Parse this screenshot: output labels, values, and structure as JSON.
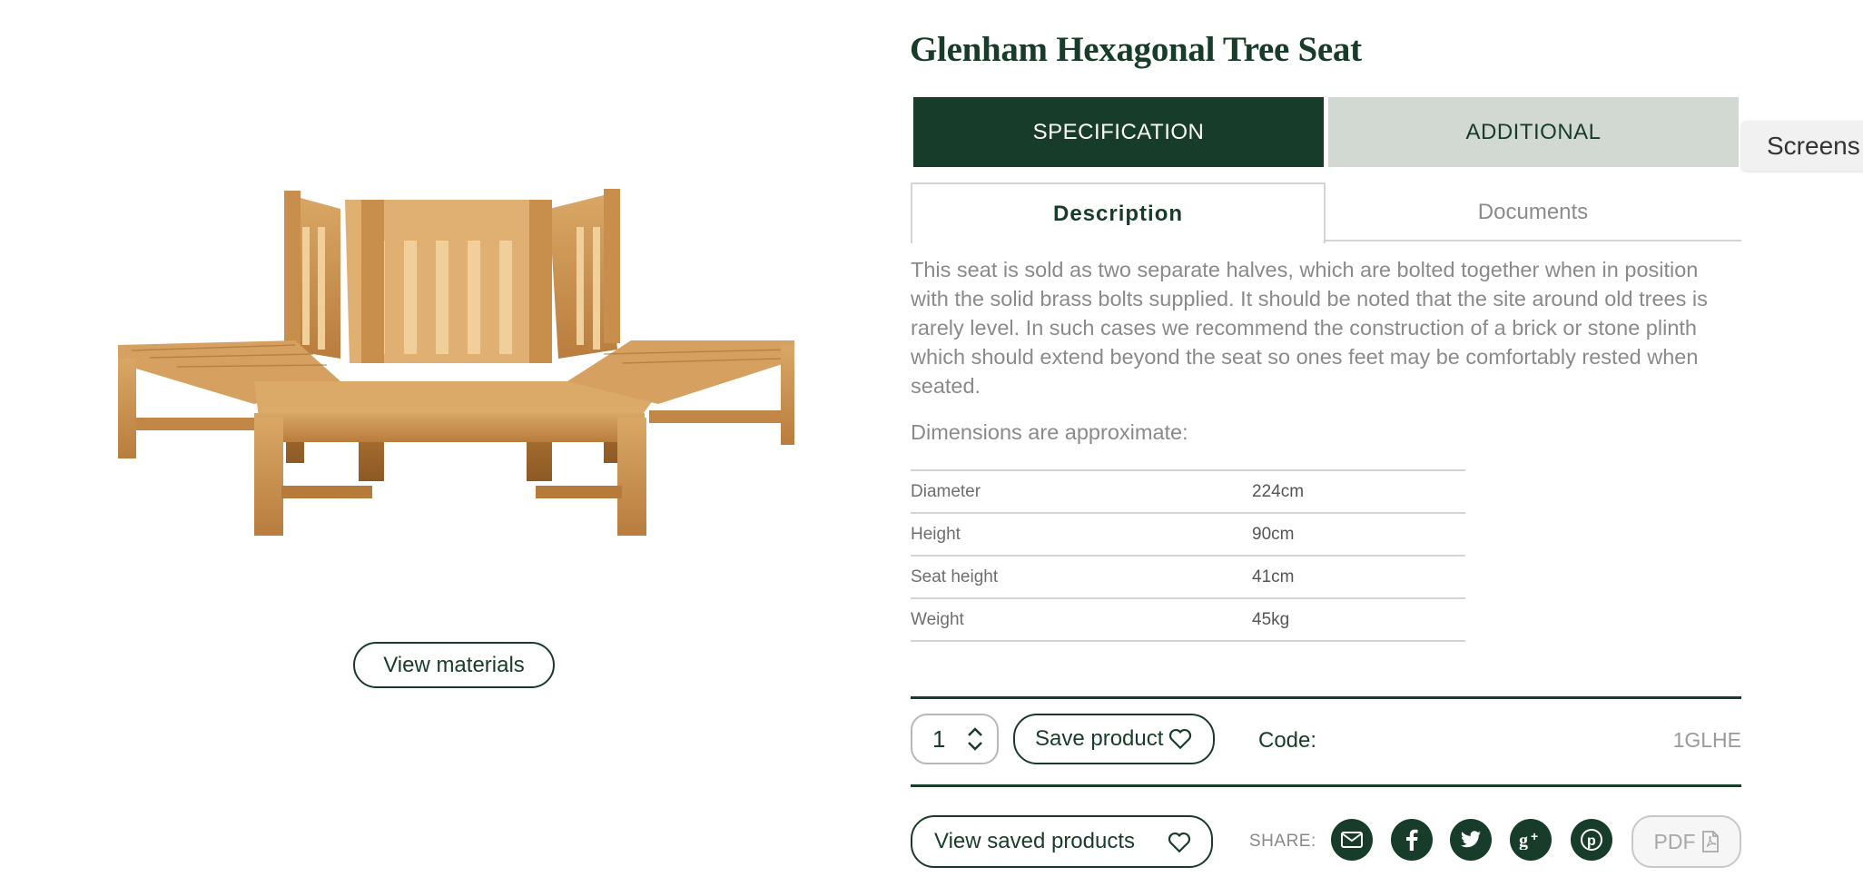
{
  "product": {
    "title": "Glenham Hexagonal Tree Seat",
    "view_materials_label": "View materials"
  },
  "tabs": {
    "main": [
      {
        "label": "SPECIFICATION",
        "active": true
      },
      {
        "label": "ADDITIONAL",
        "active": false
      }
    ],
    "sub": [
      {
        "label": "Description",
        "active": true
      },
      {
        "label": "Documents",
        "active": false
      }
    ],
    "screens_tab_label": "Screens"
  },
  "description": {
    "text": "This seat is sold as two separate halves, which are bolted together when in position with the solid brass bolts supplied. It should be noted that the site around old trees is rarely level. In such cases we recommend the construction of a brick or stone plinth which should extend beyond the seat so ones feet may be comfortably rested when seated.",
    "dimensions_heading": "Dimensions are approximate:",
    "dimensions": [
      {
        "label": "Diameter",
        "value": "224cm"
      },
      {
        "label": "Height",
        "value": "90cm"
      },
      {
        "label": "Seat height",
        "value": "41cm"
      },
      {
        "label": "Weight",
        "value": "45kg"
      }
    ]
  },
  "actions": {
    "quantity": "1",
    "save_product_label": "Save product",
    "code_label": "Code:",
    "code_value": "1GLHE",
    "view_saved_label": "View saved products",
    "share_label": "SHARE:",
    "share_icons": [
      "email-icon",
      "facebook-icon",
      "twitter-icon",
      "google-plus-icon",
      "pinterest-icon"
    ],
    "pdf_label": "PDF"
  },
  "colors": {
    "brand_green": "#173d2a",
    "inactive_tab": "#d2d9d3",
    "body_text": "#8a8a8a"
  }
}
